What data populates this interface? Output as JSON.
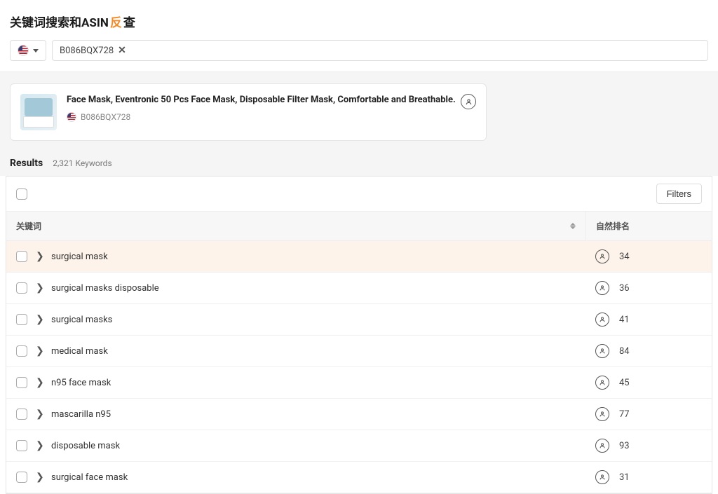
{
  "page_title_pre": "关键词搜索和ASIN",
  "page_title_highlight": "反",
  "page_title_post": "查",
  "search": {
    "asin_chip": "B086BQX728"
  },
  "product": {
    "title": "Face Mask, Eventronic 50 Pcs Face Mask, Disposable Filter Mask, Comfortable and Breathable.",
    "asin": "B086BQX728"
  },
  "results": {
    "label": "Results",
    "count_text": "2,321 Keywords"
  },
  "filters_label": "Filters",
  "columns": {
    "keyword": "关键词",
    "rank": "自然排名"
  },
  "rows": [
    {
      "keyword": "surgical mask",
      "rank": "34",
      "selected": true
    },
    {
      "keyword": "surgical masks disposable",
      "rank": "36",
      "selected": false
    },
    {
      "keyword": "surgical masks",
      "rank": "41",
      "selected": false
    },
    {
      "keyword": "medical mask",
      "rank": "84",
      "selected": false
    },
    {
      "keyword": "n95 face mask",
      "rank": "45",
      "selected": false
    },
    {
      "keyword": "mascarilla n95",
      "rank": "77",
      "selected": false
    },
    {
      "keyword": "disposable mask",
      "rank": "93",
      "selected": false
    },
    {
      "keyword": "surgical face mask",
      "rank": "31",
      "selected": false
    }
  ]
}
